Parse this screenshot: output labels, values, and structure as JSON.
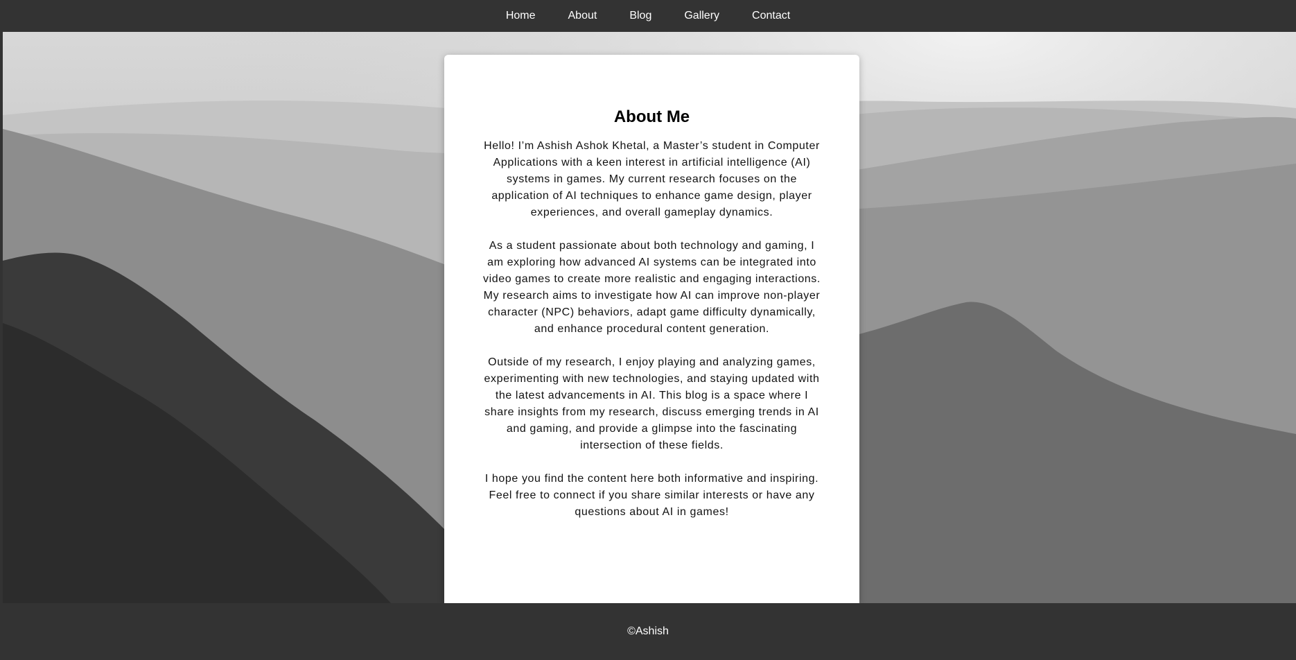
{
  "nav": {
    "items": [
      {
        "label": "Home"
      },
      {
        "label": "About"
      },
      {
        "label": "Blog"
      },
      {
        "label": "Gallery"
      },
      {
        "label": "Contact"
      }
    ]
  },
  "about": {
    "title": "About Me",
    "paragraphs": [
      "Hello! I’m Ashish Ashok Khetal, a Master’s student in Computer Applications with a keen interest in artificial intelligence (AI) systems in games. My current research focuses on the application of AI techniques to enhance game design, player experiences, and overall gameplay dynamics.",
      "As a student passionate about both technology and gaming, I am exploring how advanced AI systems can be integrated into video games to create more realistic and engaging interactions. My research aims to investigate how AI can improve non-player character (NPC) behaviors, adapt game difficulty dynamically, and enhance procedural content generation.",
      "Outside of my research, I enjoy playing and analyzing games, experimenting with new technologies, and staying updated with the latest advancements in AI. This blog is a space where I share insights from my research, discuss emerging trends in AI and gaming, and provide a glimpse into the fascinating intersection of these fields.",
      "I hope you find the content here both informative and inspiring. Feel free to connect if you share similar interests or have any questions about AI in games!"
    ]
  },
  "footer": {
    "text": "©Ashish"
  },
  "colors": {
    "nav_bg": "#333333",
    "footer_bg": "#333333",
    "card_bg": "#ffffff",
    "nav_text": "#ffffff"
  }
}
